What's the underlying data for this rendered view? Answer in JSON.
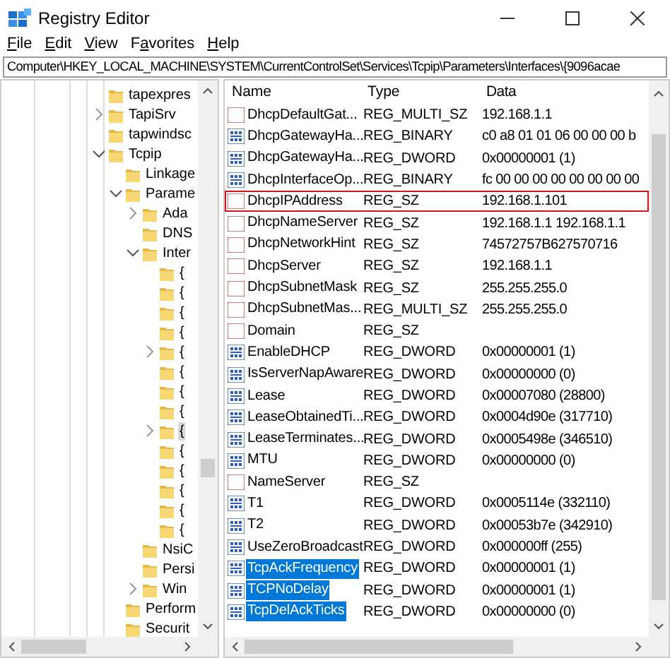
{
  "window": {
    "title": "Registry Editor"
  },
  "menu": [
    {
      "accel": "F",
      "rest": "ile"
    },
    {
      "accel": "E",
      "rest": "dit"
    },
    {
      "accel": "V",
      "rest": "iew"
    },
    {
      "lead": "F",
      "accel": "a",
      "rest": "vorites"
    },
    {
      "accel": "H",
      "rest": "elp"
    }
  ],
  "address": "Computer\\HKEY_LOCAL_MACHINE\\SYSTEM\\CurrentControlSet\\Services\\Tcpip\\Parameters\\Interfaces\\{9096acae",
  "tree": [
    {
      "label": "tapexpres",
      "selected": false
    },
    {
      "label": "TapiSrv",
      "expanded": false,
      "selected": false
    },
    {
      "label": "tapwindsc",
      "selected": false
    },
    {
      "label": "Tcpip",
      "expanded": true,
      "selected": false,
      "children": [
        {
          "label": "Linkage",
          "selected": false
        },
        {
          "label": "Parame",
          "expanded": true,
          "selected": false,
          "children": [
            {
              "label": "Ada",
              "expanded": false,
              "selected": false
            },
            {
              "label": "DNS",
              "selected": false
            },
            {
              "label": "Inter",
              "expanded": true,
              "selected": false,
              "children": [
                {
                  "label": "{",
                  "selected": false
                },
                {
                  "label": "{",
                  "selected": false
                },
                {
                  "label": "{",
                  "selected": false
                },
                {
                  "label": "{",
                  "selected": false
                },
                {
                  "label": "{",
                  "expanded": false,
                  "selected": false
                },
                {
                  "label": "{",
                  "selected": false
                },
                {
                  "label": "{",
                  "selected": false
                },
                {
                  "label": "{",
                  "selected": false
                },
                {
                  "label": "{",
                  "expanded": false,
                  "selected": true
                },
                {
                  "label": "{",
                  "selected": false
                },
                {
                  "label": "{",
                  "selected": false
                },
                {
                  "label": "{",
                  "selected": false
                },
                {
                  "label": "{",
                  "selected": false
                },
                {
                  "label": "{",
                  "selected": false
                }
              ]
            },
            {
              "label": "NsiC",
              "selected": false
            },
            {
              "label": "Persi",
              "selected": false
            },
            {
              "label": "Win",
              "expanded": false,
              "selected": false
            }
          ]
        },
        {
          "label": "Perform",
          "selected": false
        },
        {
          "label": "Securit",
          "selected": false
        }
      ]
    }
  ],
  "table": {
    "columns": [
      "Name",
      "Type",
      "Data"
    ],
    "rows": [
      {
        "kind": "string",
        "name": "DhcpDefaultGat...",
        "type": "REG_MULTI_SZ",
        "data": "192.168.1.1",
        "selected": false,
        "outlined": false
      },
      {
        "kind": "binary",
        "name": "DhcpGatewayHa...",
        "type": "REG_BINARY",
        "data": "c0 a8 01 01 06 00 00 00 b",
        "selected": false,
        "outlined": false
      },
      {
        "kind": "binary",
        "name": "DhcpGatewayHa...",
        "type": "REG_DWORD",
        "data": "0x00000001 (1)",
        "selected": false,
        "outlined": false
      },
      {
        "kind": "binary",
        "name": "DhcpInterfaceOp...",
        "type": "REG_BINARY",
        "data": "fc 00 00 00 00 00 00 00 00",
        "selected": false,
        "outlined": false
      },
      {
        "kind": "string",
        "name": "DhcpIPAddress",
        "type": "REG_SZ",
        "data": "192.168.1.101",
        "selected": false,
        "outlined": true
      },
      {
        "kind": "string",
        "name": "DhcpNameServer",
        "type": "REG_SZ",
        "data": "192.168.1.1 192.168.1.1",
        "selected": false,
        "outlined": false
      },
      {
        "kind": "string",
        "name": "DhcpNetworkHint",
        "type": "REG_SZ",
        "data": "74572757B627570716",
        "selected": false,
        "outlined": false
      },
      {
        "kind": "string",
        "name": "DhcpServer",
        "type": "REG_SZ",
        "data": "192.168.1.1",
        "selected": false,
        "outlined": false
      },
      {
        "kind": "string",
        "name": "DhcpSubnetMask",
        "type": "REG_SZ",
        "data": "255.255.255.0",
        "selected": false,
        "outlined": false
      },
      {
        "kind": "string",
        "name": "DhcpSubnetMas...",
        "type": "REG_MULTI_SZ",
        "data": "255.255.255.0",
        "selected": false,
        "outlined": false
      },
      {
        "kind": "string",
        "name": "Domain",
        "type": "REG_SZ",
        "selected": false,
        "outlined": false
      },
      {
        "kind": "binary",
        "name": "EnableDHCP",
        "type": "REG_DWORD",
        "data": "0x00000001 (1)",
        "selected": false,
        "outlined": false
      },
      {
        "kind": "binary",
        "name": "IsServerNapAware",
        "type": "REG_DWORD",
        "data": "0x00000000 (0)",
        "selected": false,
        "outlined": false
      },
      {
        "kind": "binary",
        "name": "Lease",
        "type": "REG_DWORD",
        "data": "0x00007080 (28800)",
        "selected": false,
        "outlined": false
      },
      {
        "kind": "binary",
        "name": "LeaseObtainedTi...",
        "type": "REG_DWORD",
        "data": "0x0004d90e (317710)",
        "selected": false,
        "outlined": false
      },
      {
        "kind": "binary",
        "name": "LeaseTerminates...",
        "type": "REG_DWORD",
        "data": "0x0005498e (346510)",
        "selected": false,
        "outlined": false
      },
      {
        "kind": "binary",
        "name": "MTU",
        "type": "REG_DWORD",
        "data": "0x00000000 (0)",
        "selected": false,
        "outlined": false
      },
      {
        "kind": "string",
        "name": "NameServer",
        "type": "REG_SZ",
        "selected": false,
        "outlined": false
      },
      {
        "kind": "binary",
        "name": "T1",
        "type": "REG_DWORD",
        "data": "0x0005114e (332110)",
        "selected": false,
        "outlined": false
      },
      {
        "kind": "binary",
        "name": "T2",
        "type": "REG_DWORD",
        "data": "0x00053b7e (342910)",
        "selected": false,
        "outlined": false
      },
      {
        "kind": "binary",
        "name": "UseZeroBroadcast",
        "type": "REG_DWORD",
        "data": "0x000000ff (255)",
        "selected": false,
        "outlined": false
      },
      {
        "kind": "binary",
        "name": "TcpAckFrequency",
        "type": "REG_DWORD",
        "data": "0x00000001 (1)",
        "selected": true,
        "outlined": false
      },
      {
        "kind": "binary",
        "name": "TCPNoDelay",
        "type": "REG_DWORD",
        "data": "0x00000001 (1)",
        "selected": true,
        "outlined": false
      },
      {
        "kind": "binary",
        "name": "TcpDelAckTicks",
        "type": "REG_DWORD",
        "data": "0x00000000 (0)",
        "selected": true,
        "outlined": false
      }
    ]
  }
}
